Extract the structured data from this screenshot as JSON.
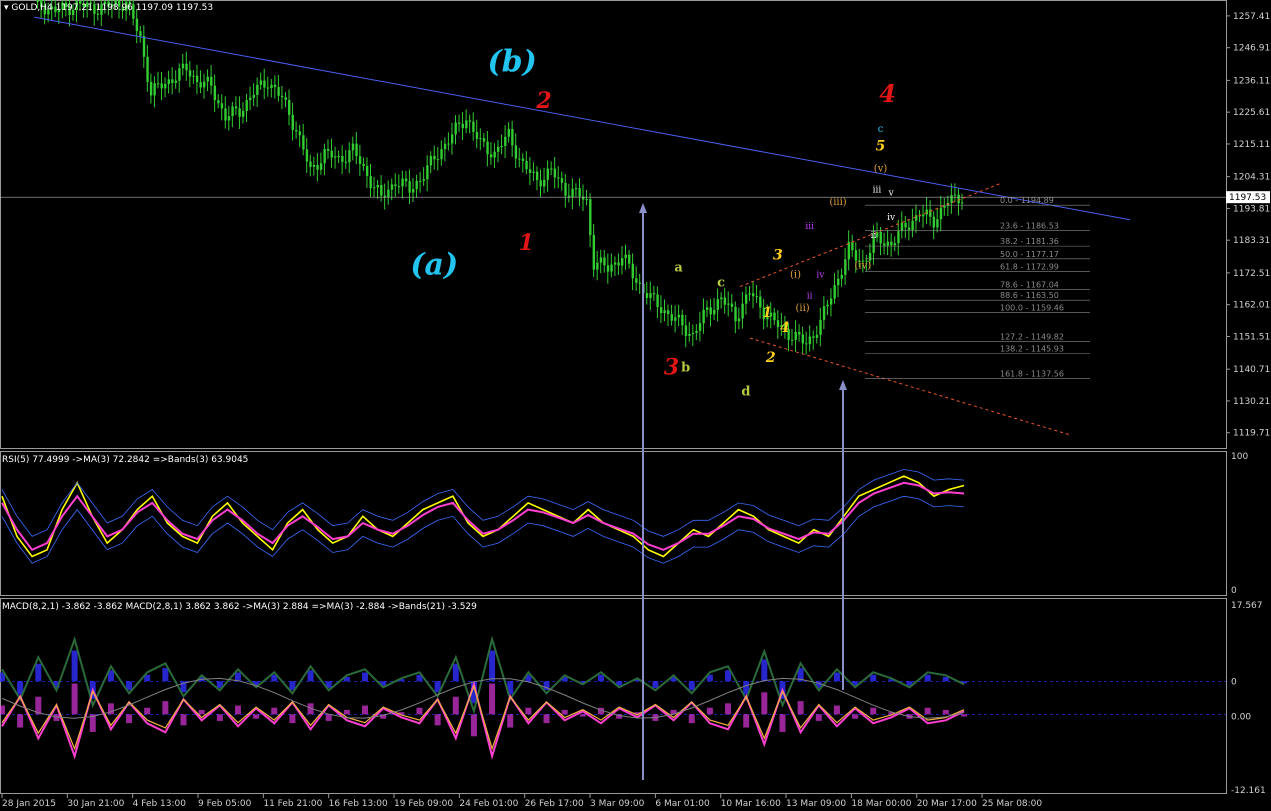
{
  "header": {
    "symbol_line": "GOLD,H4  1197.21 1198.96 1197.09 1197.53",
    "rsi_line": "RSI(5) 77.4999  ->MA(3) 72.2842  =>Bands(3) 63.9045",
    "macd_line": "MACD(8,2,1) -3.862 -3.862  MACD(2,8,1) 3.862 3.862  ->MA(3) 2.884  =>MA(3) -2.884  ->Bands(21) -3.529"
  },
  "colors": {
    "background": "#000000",
    "candle": "#32cd32",
    "trendline": "#4a5ef0",
    "channel": "#e8542a",
    "fib": "#8a8a8a",
    "rsi_line": "#ffff00",
    "rsi_ma": "#ff3fd0",
    "rsi_band": "#3a6cff",
    "macd_pos": "#3030ff",
    "macd_neg": "#ff40ff",
    "arrow": "#8a8fc8",
    "current_price_line": "#b0b0b0"
  },
  "chart_data": [
    {
      "type": "candlestick",
      "title": "GOLD,H4",
      "ylim": [
        1115,
        1262
      ],
      "y_ticks": [
        "1257.41",
        "1246.91",
        "1236.11",
        "1225.61",
        "1215.11",
        "1204.31",
        "1193.81",
        "1183.31",
        "1172.51",
        "1162.01",
        "1151.51",
        "1140.71",
        "1130.21",
        "1119.71"
      ],
      "current_price": "1197.53",
      "x_labels": [
        "28 Jan 2015",
        "30 Jan 21:00",
        "4 Feb 13:00",
        "9 Feb 05:00",
        "11 Feb 21:00",
        "16 Feb 13:00",
        "19 Feb 09:00",
        "24 Feb 01:00",
        "26 Feb 17:00",
        "3 Mar 09:00",
        "6 Mar 01:00",
        "10 Mar 16:00",
        "13 Mar 09:00",
        "18 Mar 00:00",
        "20 Mar 17:00",
        "25 Mar 08:00"
      ],
      "close_path": [
        [
          0,
          1262
        ],
        [
          6,
          1259
        ],
        [
          12,
          1261
        ],
        [
          18,
          1260
        ],
        [
          26,
          1262
        ],
        [
          30,
          1250
        ],
        [
          33,
          1232
        ],
        [
          38,
          1236
        ],
        [
          43,
          1240
        ],
        [
          46,
          1236
        ],
        [
          50,
          1234
        ],
        [
          54,
          1224
        ],
        [
          58,
          1226
        ],
        [
          62,
          1232
        ],
        [
          66,
          1236
        ],
        [
          70,
          1230
        ],
        [
          74,
          1220
        ],
        [
          78,
          1206
        ],
        [
          82,
          1212
        ],
        [
          86,
          1210
        ],
        [
          90,
          1213
        ],
        [
          94,
          1205
        ],
        [
          98,
          1197
        ],
        [
          102,
          1203
        ],
        [
          106,
          1200
        ],
        [
          110,
          1205
        ],
        [
          114,
          1212
        ],
        [
          118,
          1218
        ],
        [
          122,
          1224
        ],
        [
          126,
          1215
        ],
        [
          130,
          1212
        ],
        [
          134,
          1218
        ],
        [
          138,
          1208
        ],
        [
          142,
          1203
        ],
        [
          146,
          1206
        ],
        [
          150,
          1200
        ],
        [
          154,
          1198
        ],
        [
          156,
          1196
        ],
        [
          158,
          1176
        ],
        [
          162,
          1174
        ],
        [
          166,
          1178
        ],
        [
          170,
          1170
        ],
        [
          174,
          1164
        ],
        [
          178,
          1160
        ],
        [
          182,
          1156
        ],
        [
          186,
          1152
        ],
        [
          190,
          1160
        ],
        [
          194,
          1164
        ],
        [
          198,
          1158
        ],
        [
          202,
          1166
        ],
        [
          206,
          1160
        ],
        [
          210,
          1155
        ],
        [
          214,
          1152
        ],
        [
          218,
          1149
        ],
        [
          222,
          1156
        ],
        [
          226,
          1168
        ],
        [
          230,
          1180
        ],
        [
          234,
          1176
        ],
        [
          238,
          1184
        ],
        [
          242,
          1182
        ],
        [
          246,
          1188
        ],
        [
          250,
          1192
        ],
        [
          254,
          1190
        ],
        [
          258,
          1196
        ],
        [
          262,
          1198
        ]
      ],
      "trendline": {
        "from": [
          0,
          1257
        ],
        "to": [
          262,
          1196
        ]
      },
      "fib_levels": [
        {
          "label": "0.0 - 1194.89",
          "price": 1194.89
        },
        {
          "label": "23.6 - 1186.53",
          "price": 1186.53
        },
        {
          "label": "38.2 - 1181.36",
          "price": 1181.36
        },
        {
          "label": "50.0 - 1177.17",
          "price": 1177.17
        },
        {
          "label": "61.8 - 1172.99",
          "price": 1172.99
        },
        {
          "label": "78.6 - 1167.04",
          "price": 1167.04
        },
        {
          "label": "88.6 - 1163.50",
          "price": 1163.5
        },
        {
          "label": "100.0 - 1159.46",
          "price": 1159.46
        },
        {
          "label": "127.2 - 1149.82",
          "price": 1149.82
        },
        {
          "label": "138.2 - 1145.93",
          "price": 1145.93
        },
        {
          "label": "161.8 - 1137.56",
          "price": 1137.56
        }
      ],
      "annotations": [
        {
          "text": "(b)",
          "i": 135,
          "price": 1239,
          "color": "#22c4f0",
          "size": 30,
          "italic": true
        },
        {
          "text": "(a)",
          "i": 113,
          "price": 1172,
          "color": "#22c4f0",
          "size": 30,
          "italic": true
        },
        {
          "text": "2",
          "i": 144,
          "price": 1227,
          "color": "#e01515",
          "size": 22,
          "italic": true
        },
        {
          "text": "1",
          "i": 139,
          "price": 1180,
          "color": "#e01515",
          "size": 22,
          "italic": true
        },
        {
          "text": "3",
          "i": 180,
          "price": 1139,
          "color": "#e01515",
          "size": 22,
          "italic": true
        },
        {
          "text": "4",
          "i": 241,
          "price": 1229,
          "color": "#e01515",
          "size": 24,
          "italic": true
        },
        {
          "text": "a",
          "i": 182,
          "price": 1173,
          "color": "#b8c840",
          "size": 13
        },
        {
          "text": "c",
          "i": 194,
          "price": 1168,
          "color": "#b8c840",
          "size": 13
        },
        {
          "text": "b",
          "i": 184,
          "price": 1140,
          "color": "#b8c840",
          "size": 13
        },
        {
          "text": "d",
          "i": 201,
          "price": 1132,
          "color": "#b8c840",
          "size": 13
        },
        {
          "text": "1",
          "i": 207,
          "price": 1158,
          "color": "#ffd21a",
          "size": 14,
          "italic": true
        },
        {
          "text": "2",
          "i": 208,
          "price": 1143,
          "color": "#ffd21a",
          "size": 14,
          "italic": true
        },
        {
          "text": "3",
          "i": 210,
          "price": 1177,
          "color": "#ffd21a",
          "size": 14,
          "italic": true
        },
        {
          "text": "4",
          "i": 212,
          "price": 1153,
          "color": "#ffd21a",
          "size": 14,
          "italic": true
        },
        {
          "text": "5",
          "i": 239,
          "price": 1213,
          "color": "#ffd21a",
          "size": 14,
          "italic": true
        },
        {
          "text": "c",
          "i": 239,
          "price": 1219,
          "color": "#22c4f0",
          "size": 10
        },
        {
          "text": "(i)",
          "i": 215,
          "price": 1171,
          "color": "#e0a040",
          "size": 10
        },
        {
          "text": "(ii)",
          "i": 217,
          "price": 1160,
          "color": "#e0a040",
          "size": 10
        },
        {
          "text": "(iii)",
          "i": 227,
          "price": 1195,
          "color": "#e0a040",
          "size": 10
        },
        {
          "text": "(iv)",
          "i": 234,
          "price": 1174,
          "color": "#e0a040",
          "size": 10
        },
        {
          "text": "(v)",
          "i": 239,
          "price": 1206,
          "color": "#e0a040",
          "size": 10
        },
        {
          "text": "iv",
          "i": 222,
          "price": 1171,
          "color": "#c040ff",
          "size": 9
        },
        {
          "text": "ii",
          "i": 219,
          "price": 1164,
          "color": "#c040ff",
          "size": 9
        },
        {
          "text": "iii",
          "i": 219,
          "price": 1187,
          "color": "#c040ff",
          "size": 9
        },
        {
          "text": "v",
          "i": 242,
          "price": 1198,
          "color": "#ffffff",
          "size": 9
        },
        {
          "text": "iv",
          "i": 242,
          "price": 1190,
          "color": "#ffffff",
          "size": 9
        },
        {
          "text": "iii",
          "i": 238,
          "price": 1199,
          "color": "#ffffff",
          "size": 9
        },
        {
          "text": "ii",
          "i": 237,
          "price": 1184,
          "color": "#ffffff",
          "size": 9
        }
      ]
    },
    {
      "type": "line",
      "title": "RSI(5)",
      "ylim": [
        0,
        100
      ],
      "y_ticks": [
        "100",
        "0"
      ],
      "series": [
        {
          "name": "RSI(5)",
          "values": [
            70,
            40,
            25,
            30,
            60,
            80,
            55,
            35,
            45,
            60,
            70,
            50,
            40,
            35,
            55,
            65,
            50,
            40,
            30,
            50,
            60,
            45,
            35,
            40,
            55,
            45,
            40,
            50,
            60,
            65,
            70,
            50,
            40,
            45,
            55,
            65,
            60,
            55,
            50,
            60,
            50,
            45,
            40,
            30,
            25,
            35,
            45,
            40,
            50,
            60,
            55,
            45,
            40,
            35,
            45,
            40,
            55,
            70,
            75,
            80,
            85,
            80,
            70,
            75,
            78
          ]
        },
        {
          "name": "MA(3)",
          "values": [
            65,
            45,
            30,
            35,
            55,
            70,
            55,
            40,
            45,
            58,
            65,
            52,
            42,
            38,
            52,
            60,
            52,
            42,
            35,
            48,
            55,
            47,
            38,
            40,
            50,
            45,
            42,
            48,
            56,
            62,
            65,
            52,
            42,
            45,
            52,
            60,
            58,
            54,
            50,
            56,
            50,
            46,
            42,
            34,
            30,
            35,
            42,
            42,
            48,
            55,
            53,
            46,
            42,
            38,
            43,
            42,
            52,
            65,
            72,
            76,
            80,
            78,
            72,
            73,
            72
          ]
        }
      ]
    },
    {
      "type": "bar",
      "title": "MACD",
      "ylim": [
        -12.161,
        17.567
      ],
      "y_ticks": [
        "17.567",
        "0",
        "0.00",
        "-12.161"
      ],
      "values": [
        4,
        -6,
        8,
        -3,
        14,
        -8,
        5,
        -4,
        3,
        6,
        -5,
        2,
        -3,
        4,
        -2,
        3,
        -4,
        5,
        -3,
        2,
        4,
        -2,
        1,
        3,
        -5,
        8,
        -10,
        14,
        -6,
        3,
        -4,
        2,
        -1,
        3,
        -2,
        1,
        -3,
        2,
        -4,
        3,
        5,
        -6,
        10,
        -8,
        6,
        -3,
        4,
        -2,
        3,
        1,
        -2,
        3,
        2,
        -1
      ]
    }
  ]
}
